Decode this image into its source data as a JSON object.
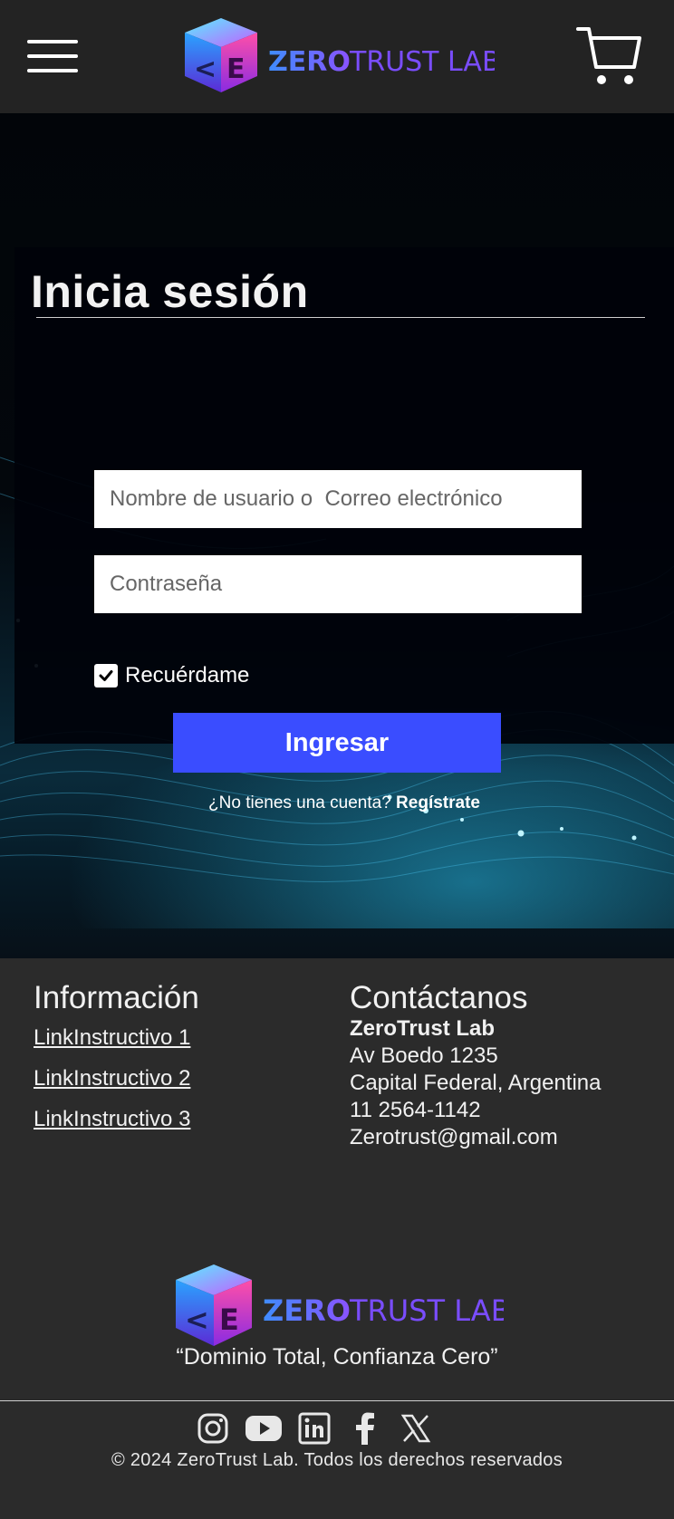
{
  "header": {
    "brand_primary": "ZERO",
    "brand_secondary": "TRUST LAB",
    "menu_icon": "hamburger-menu-icon",
    "cart_icon": "shopping-cart-icon"
  },
  "login": {
    "title": "Inicia sesión",
    "username_placeholder": "Nombre de usuario o  Correo electrónico",
    "password_placeholder": "Contraseña",
    "remember_label": "Recuérdame",
    "remember_checked": true,
    "submit_label": "Ingresar",
    "signup_prompt": "¿No tienes una cuenta?",
    "signup_link": "Regístrate"
  },
  "footer": {
    "info_title": "Información",
    "info_links": [
      "LinkInstructivo 1",
      "LinkInstructivo 2",
      "LinkInstructivo 3"
    ],
    "contact_title": "Contáctanos",
    "contact_name": "ZeroTrust Lab",
    "contact_lines": [
      "Av Boedo 1235",
      "Capital Federal, Argentina",
      "11 2564-1142",
      "Zerotrust@gmail.com"
    ],
    "brand_primary": "ZERO",
    "brand_secondary": "TRUST LAB",
    "slogan": "“Dominio Total, Confianza Cero”",
    "socials": [
      "instagram-icon",
      "youtube-icon",
      "linkedin-icon",
      "facebook-icon",
      "x-icon"
    ],
    "copyright": "© 2024 ZeroTrust Lab. Todos los derechos reservados"
  },
  "colors": {
    "header_bg": "#232323",
    "footer_bg": "#2b2b2b",
    "button_blue": "#3a4dff",
    "brand_blue": "#3b7bff",
    "brand_purple": "#7a4dff"
  }
}
